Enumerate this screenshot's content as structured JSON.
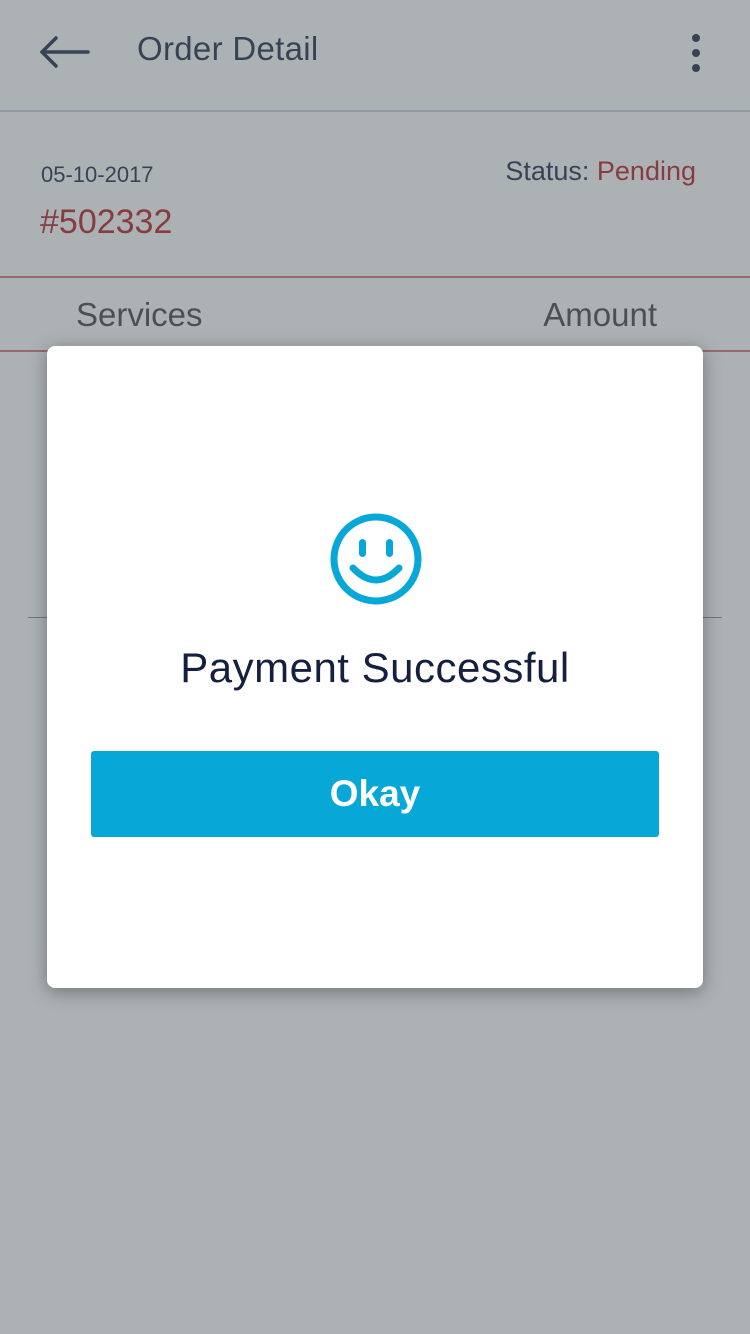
{
  "header": {
    "title": "Order Detail",
    "back_icon": "arrow-left-icon",
    "menu_icon": "more-vertical-icon"
  },
  "order": {
    "date": "05-10-2017",
    "id": "#502332",
    "status_label": "Status: ",
    "status_value": "Pending"
  },
  "table": {
    "columns": [
      "Services",
      "Amount"
    ]
  },
  "dialog": {
    "icon": "smiley-icon",
    "message": "Payment Successful",
    "button_label": "Okay"
  },
  "colors": {
    "accent": "#07a8d8",
    "status_pending": "#b31318",
    "text_primary": "#152040",
    "overlay": "rgba(90,102,106,0.5)"
  }
}
